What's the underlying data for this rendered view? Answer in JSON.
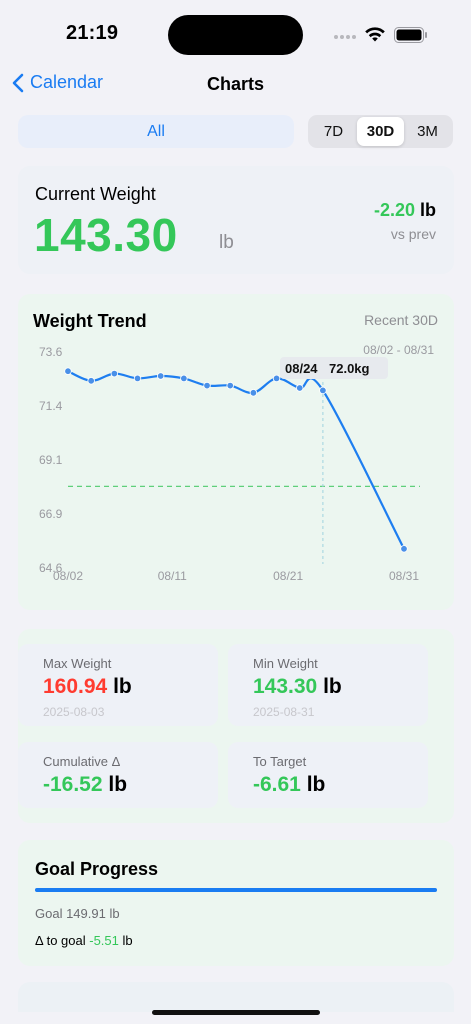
{
  "status_bar": {
    "time": "21:19"
  },
  "nav": {
    "back_label": "Calendar",
    "title": "Charts"
  },
  "filter": {
    "all_label": "All"
  },
  "range_tabs": [
    {
      "label": "7D",
      "active": false
    },
    {
      "label": "30D",
      "active": true
    },
    {
      "label": "3M",
      "active": false
    }
  ],
  "current_weight": {
    "label": "Current Weight",
    "value": "143.30",
    "unit": "lb",
    "delta_value": "-2.20",
    "delta_unit": "lb",
    "vs": "vs prev"
  },
  "trend": {
    "title": "Weight Trend",
    "range_label": "Recent 30D",
    "date_range": "08/02 - 08/31",
    "tooltip_date": "08/24",
    "tooltip_value": "72.0kg"
  },
  "chart_data": {
    "type": "line",
    "y_ticks": [
      "73.6",
      "71.4",
      "69.1",
      "66.9",
      "64.6"
    ],
    "x_ticks": [
      "08/02",
      "08/11",
      "08/21",
      "08/31"
    ],
    "ylim": [
      64.6,
      73.6
    ],
    "xlim": [
      0,
      29
    ],
    "target": 68.0,
    "selected_index": 22,
    "series": [
      {
        "x": [
          0,
          2,
          4,
          6,
          8,
          10,
          12,
          14,
          16,
          18,
          20,
          22,
          29
        ],
        "values": [
          72.8,
          72.4,
          72.7,
          72.5,
          72.6,
          72.5,
          72.2,
          72.2,
          71.9,
          72.5,
          72.1,
          72.0,
          65.4
        ]
      }
    ]
  },
  "stats": {
    "max": {
      "label": "Max Weight",
      "value": "160.94",
      "unit": "lb",
      "date": "2025-08-03"
    },
    "min": {
      "label": "Min Weight",
      "value": "143.30",
      "unit": "lb",
      "date": "2025-08-31"
    },
    "cumulative": {
      "label": "Cumulative Δ",
      "value": "-16.52",
      "unit": "lb"
    },
    "to_target": {
      "label": "To Target",
      "value": "-6.61",
      "unit": "lb"
    }
  },
  "goal": {
    "title": "Goal Progress",
    "progress": 1.0,
    "goal_line": "Goal 149.91 lb",
    "delta_label": "Δ to goal",
    "delta_value": "-5.51",
    "delta_unit": "lb"
  },
  "colors": {
    "accent": "#1a7cf2",
    "positive": "#34c759",
    "negative": "#ff3b30",
    "chart_line": "#1e7ef0",
    "target_line": "#5fcf7a"
  }
}
